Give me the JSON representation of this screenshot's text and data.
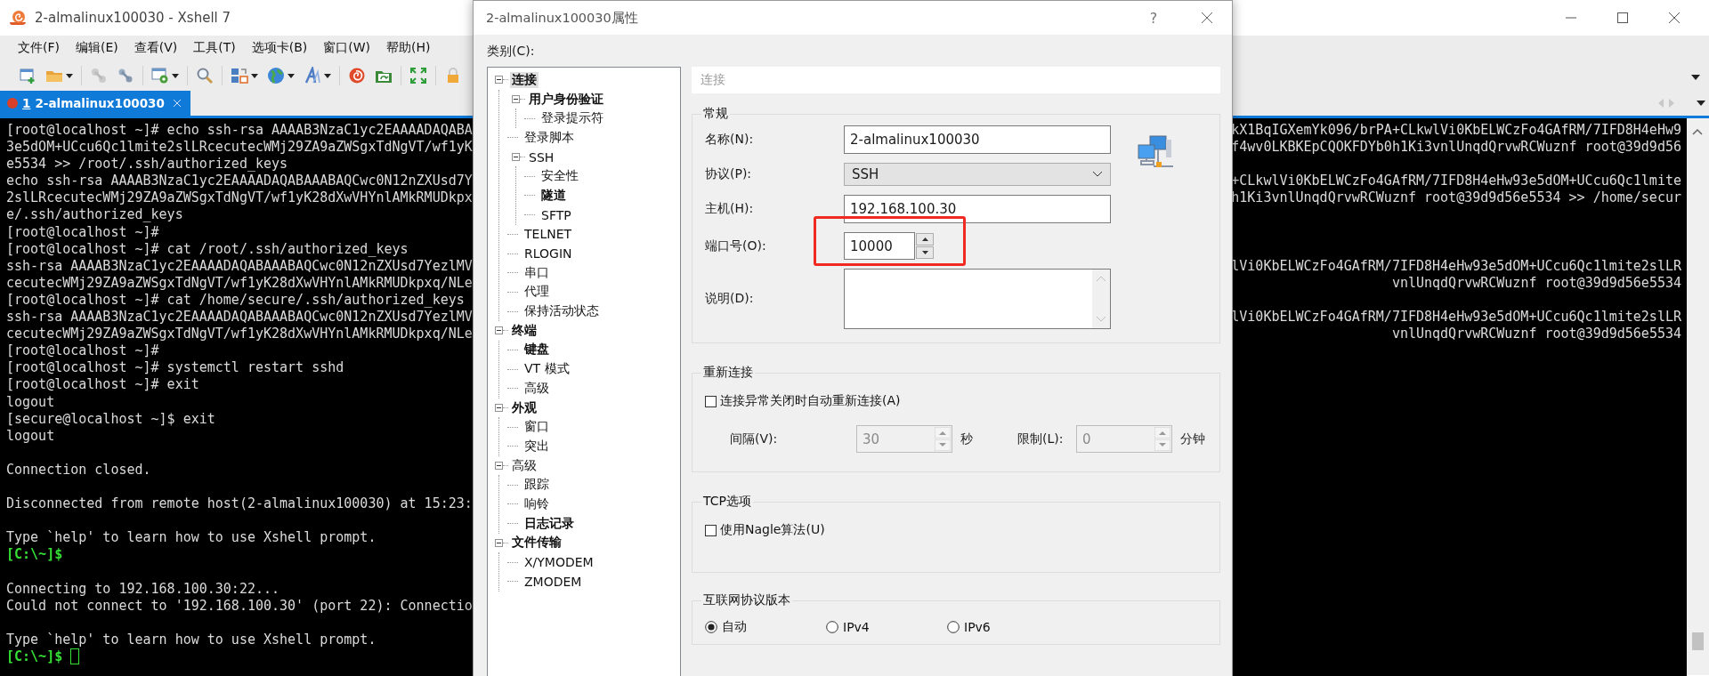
{
  "main_window": {
    "title": "2-almalinux100030 - Xshell 7",
    "menu": [
      "文件(F)",
      "编辑(E)",
      "查看(V)",
      "工具(T)",
      "选项卡(B)",
      "窗口(W)",
      "帮助(H)"
    ],
    "tabs": [
      {
        "number": "1",
        "label": "2-almalinux100030",
        "selected": true
      }
    ],
    "terminal": {
      "cursor": true,
      "lines": [
        {
          "kind": "output",
          "text": "[root@localhost ~]# echo ssh-rsa AAAAB3NzaC1yc2EAAAADAQABA",
          "right": "kX1BqIGXemYk096/brPA+CLkwlVi0KbELWCzFo4GAfRM/7IFD8H4eHw9"
        },
        {
          "kind": "output",
          "text": "3e5dOM+UCcu6Qc1lmite2slLRcecutecWMj29ZA9aZWSgxTdNgVT/wf1yK",
          "right": "f4wv0LKBKEpCQOKFDYb0h1Ki3vnlUnqdQrvwRCWuznf root@39d9d56"
        },
        {
          "kind": "output",
          "text": "e5534 >> /root/.ssh/authorized_keys"
        },
        {
          "kind": "output",
          "text": "echo ssh-rsa AAAAB3NzaC1yc2EAAAADAQABAAABAQCwc0N12nZXUsd7Y",
          "right": "+CLkwlVi0KbELWCzFo4GAfRM/7IFD8H4eHw93e5dOM+UCcu6Qc1lmite"
        },
        {
          "kind": "output",
          "text": "2slLRcecutecWMj29ZA9aZWSgxTdNgVT/wf1yK28dXwVHYnlAMkRMUDkpx",
          "right": "h1Ki3vnlUnqdQrvwRCWuznf root@39d9d56e5534 >> /home/secur"
        },
        {
          "kind": "output",
          "text": "e/.ssh/authorized_keys"
        },
        {
          "kind": "output",
          "text": "[root@localhost ~]#"
        },
        {
          "kind": "output",
          "text": "[root@localhost ~]# cat /root/.ssh/authorized_keys"
        },
        {
          "kind": "output",
          "text": "ssh-rsa AAAAB3NzaC1yc2EAAAADAQABAAABAQCwc0N12nZXUsd7YezlMV",
          "right": "lVi0KbELWCzFo4GAfRM/7IFD8H4eHw93e5dOM+UCcu6Qc1lmite2slLR"
        },
        {
          "kind": "output",
          "text": "cecutecWMj29ZA9aZWSgxTdNgVT/wf1yK28dXwVHYnlAMkRMUDkpxq/NLe",
          "right": "vnlUnqdQrvwRCWuznf root@39d9d56e5534"
        },
        {
          "kind": "output",
          "text": "[root@localhost ~]# cat /home/secure/.ssh/authorized_keys"
        },
        {
          "kind": "output",
          "text": "ssh-rsa AAAAB3NzaC1yc2EAAAADAQABAAABAQCwc0N12nZXUsd7YezlMV",
          "right": "lVi0KbELWCzFo4GAfRM/7IFD8H4eHw93e5dOM+UCcu6Qc1lmite2slLR"
        },
        {
          "kind": "output",
          "text": "cecutecWMj29ZA9aZWSgxTdNgVT/wf1yK28dXwVHYnlAMkRMUDkpxq/NLe",
          "right": "vnlUnqdQrvwRCWuznf root@39d9d56e5534"
        },
        {
          "kind": "output",
          "text": "[root@localhost ~]#"
        },
        {
          "kind": "output",
          "text": "[root@localhost ~]# systemctl restart sshd"
        },
        {
          "kind": "output",
          "text": "[root@localhost ~]# exit"
        },
        {
          "kind": "output",
          "text": "logout"
        },
        {
          "kind": "output",
          "text": "[secure@localhost ~]$ exit"
        },
        {
          "kind": "output",
          "text": "logout"
        },
        {
          "kind": "blank"
        },
        {
          "kind": "output",
          "text": "Connection closed."
        },
        {
          "kind": "blank"
        },
        {
          "kind": "output",
          "text": "Disconnected from remote host(2-almalinux100030) at 15:23:"
        },
        {
          "kind": "blank"
        },
        {
          "kind": "output",
          "text": "Type `help' to learn how to use Xshell prompt."
        },
        {
          "kind": "local_prompt",
          "text": "[C:\\~]$"
        },
        {
          "kind": "blank"
        },
        {
          "kind": "output",
          "text": "Connecting to 192.168.100.30:22..."
        },
        {
          "kind": "output",
          "text": "Could not connect to '192.168.100.30' (port 22): Connectio"
        },
        {
          "kind": "blank"
        },
        {
          "kind": "output",
          "text": "Type `help' to learn how to use Xshell prompt."
        },
        {
          "kind": "local_prompt",
          "text": "[C:\\~]$"
        }
      ]
    }
  },
  "dialog": {
    "title": "2-almalinux100030属性",
    "help": "?",
    "category_label": "类别(C):",
    "tree": [
      {
        "label": "连接",
        "bold": true,
        "selected": true,
        "expanded": true,
        "children": [
          {
            "label": "用户身份验证",
            "bold": true,
            "selected": false,
            "expanded": true,
            "children": [
              {
                "label": "登录提示符",
                "bold": false,
                "selected": false
              }
            ]
          },
          {
            "label": "登录脚本",
            "bold": false,
            "selected": false
          },
          {
            "label": "SSH",
            "bold": false,
            "selected": false,
            "expanded": true,
            "children": [
              {
                "label": "安全性",
                "bold": false,
                "selected": false
              },
              {
                "label": "隧道",
                "bold": true,
                "selected": false
              },
              {
                "label": "SFTP",
                "bold": false,
                "selected": false
              }
            ]
          },
          {
            "label": "TELNET",
            "bold": false,
            "selected": false
          },
          {
            "label": "RLOGIN",
            "bold": false,
            "selected": false
          },
          {
            "label": "串口",
            "bold": false,
            "selected": false
          },
          {
            "label": "代理",
            "bold": false,
            "selected": false
          },
          {
            "label": "保持活动状态",
            "bold": false,
            "selected": false
          }
        ]
      },
      {
        "label": "终端",
        "bold": true,
        "selected": false,
        "expanded": true,
        "children": [
          {
            "label": "键盘",
            "bold": true,
            "selected": false
          },
          {
            "label": "VT 模式",
            "bold": false,
            "selected": false
          },
          {
            "label": "高级",
            "bold": false,
            "selected": false
          }
        ]
      },
      {
        "label": "外观",
        "bold": true,
        "selected": false,
        "expanded": true,
        "children": [
          {
            "label": "窗口",
            "bold": false,
            "selected": false
          },
          {
            "label": "突出",
            "bold": false,
            "selected": false
          }
        ]
      },
      {
        "label": "高级",
        "bold": false,
        "selected": false,
        "expanded": true,
        "children": [
          {
            "label": "跟踪",
            "bold": false,
            "selected": false
          },
          {
            "label": "响铃",
            "bold": false,
            "selected": false
          },
          {
            "label": "日志记录",
            "bold": true,
            "selected": false
          }
        ]
      },
      {
        "label": "文件传输",
        "bold": true,
        "selected": false,
        "expanded": true,
        "children": [
          {
            "label": "X/YMODEM",
            "bold": false,
            "selected": false
          },
          {
            "label": "ZMODEM",
            "bold": false,
            "selected": false
          }
        ]
      }
    ],
    "panel_header": "连接",
    "general": {
      "title": "常规",
      "fields": [
        {
          "kind": "text",
          "label": "名称(N):",
          "value": "2-almalinux100030",
          "highlighted": false
        },
        {
          "kind": "select",
          "label": "协议(P):",
          "value": "SSH",
          "highlighted": false
        },
        {
          "kind": "text",
          "label": "主机(H):",
          "value": "192.168.100.30",
          "highlighted": false
        },
        {
          "kind": "spin",
          "label": "端口号(O):",
          "value": "10000",
          "highlighted": true
        },
        {
          "kind": "textarea",
          "label": "说明(D):",
          "highlighted": false
        }
      ]
    },
    "reconnect": {
      "title": "重新连接",
      "checkbox": {
        "label": "连接异常关闭时自动重新连接(A)",
        "checked": false
      },
      "interval": {
        "label": "间隔(V):",
        "value": "30",
        "unit": "秒",
        "disabled": true
      },
      "limit": {
        "label": "限制(L):",
        "value": "0",
        "unit": "分钟",
        "disabled": true
      }
    },
    "tcp": {
      "title": "TCP选项",
      "checkbox": {
        "label": "使用Nagle算法(U)",
        "checked": false
      }
    },
    "ip_version": {
      "title": "互联网协议版本",
      "options": [
        {
          "label": "自动",
          "selected": true
        },
        {
          "label": "IPv4",
          "selected": false
        },
        {
          "label": "IPv6",
          "selected": false
        }
      ]
    }
  }
}
